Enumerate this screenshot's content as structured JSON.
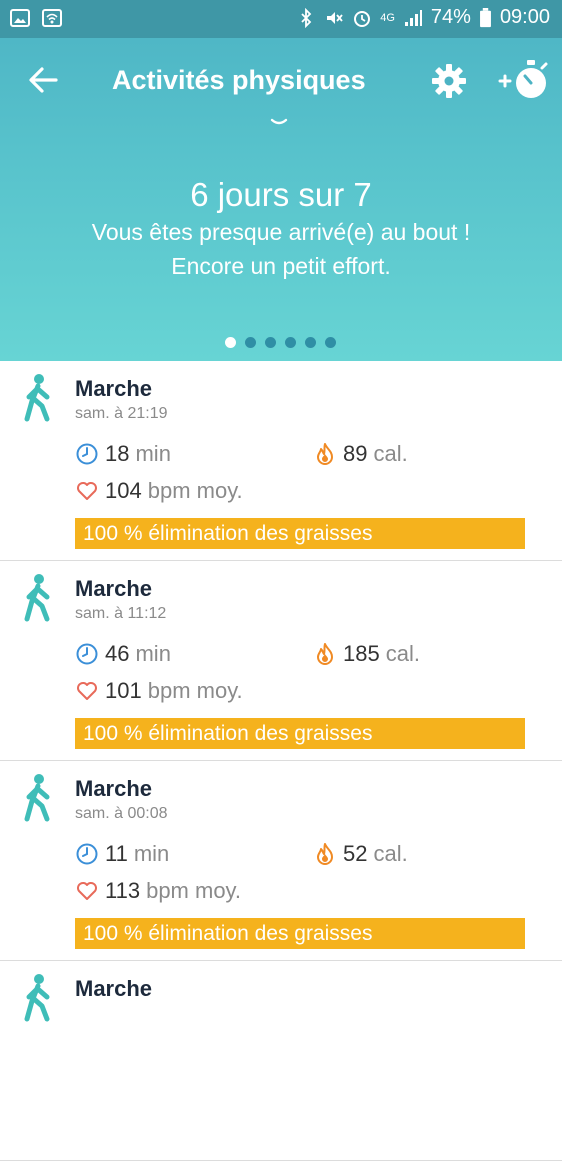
{
  "status_bar": {
    "battery": "74%",
    "time": "09:00",
    "network": "4G"
  },
  "toolbar": {
    "title": "Activités physiques"
  },
  "summary": {
    "headline": "6 jours sur 7",
    "line1": "Vous êtes presque arrivé(e) au bout !",
    "line2": "Encore un petit effort."
  },
  "pager": {
    "total": 6,
    "active_index": 0
  },
  "activities": [
    {
      "name": "Marche",
      "time": "sam. à 21:19",
      "duration": "18",
      "duration_unit": "min",
      "calories": "89",
      "calories_unit": "cal.",
      "heart_rate": "104",
      "heart_rate_unit": "bpm moy.",
      "fat_burn": "100 % élimination des graisses"
    },
    {
      "name": "Marche",
      "time": "sam. à 11:12",
      "duration": "46",
      "duration_unit": "min",
      "calories": "185",
      "calories_unit": "cal.",
      "heart_rate": "101",
      "heart_rate_unit": "bpm moy.",
      "fat_burn": "100 % élimination des graisses"
    },
    {
      "name": "Marche",
      "time": "sam. à 00:08",
      "duration": "11",
      "duration_unit": "min",
      "calories": "52",
      "calories_unit": "cal.",
      "heart_rate": "113",
      "heart_rate_unit": "bpm moy.",
      "fat_burn": "100 % élimination des graisses"
    },
    {
      "name": "Marche"
    }
  ],
  "icons": {
    "activity": "walking-person-icon",
    "duration": "clock-icon",
    "calories": "flame-icon",
    "heart_rate": "heart-icon"
  },
  "colors": {
    "header_top": "#4cb3c4",
    "header_bottom": "#67d4d4",
    "status_bar": "#3f97a6",
    "accent_teal": "#3fbdb8",
    "fat_burn_bar": "#f5b21d",
    "clock_blue": "#3b8fd8",
    "flame_orange": "#f08a24",
    "heart_red": "#e86a5a"
  }
}
